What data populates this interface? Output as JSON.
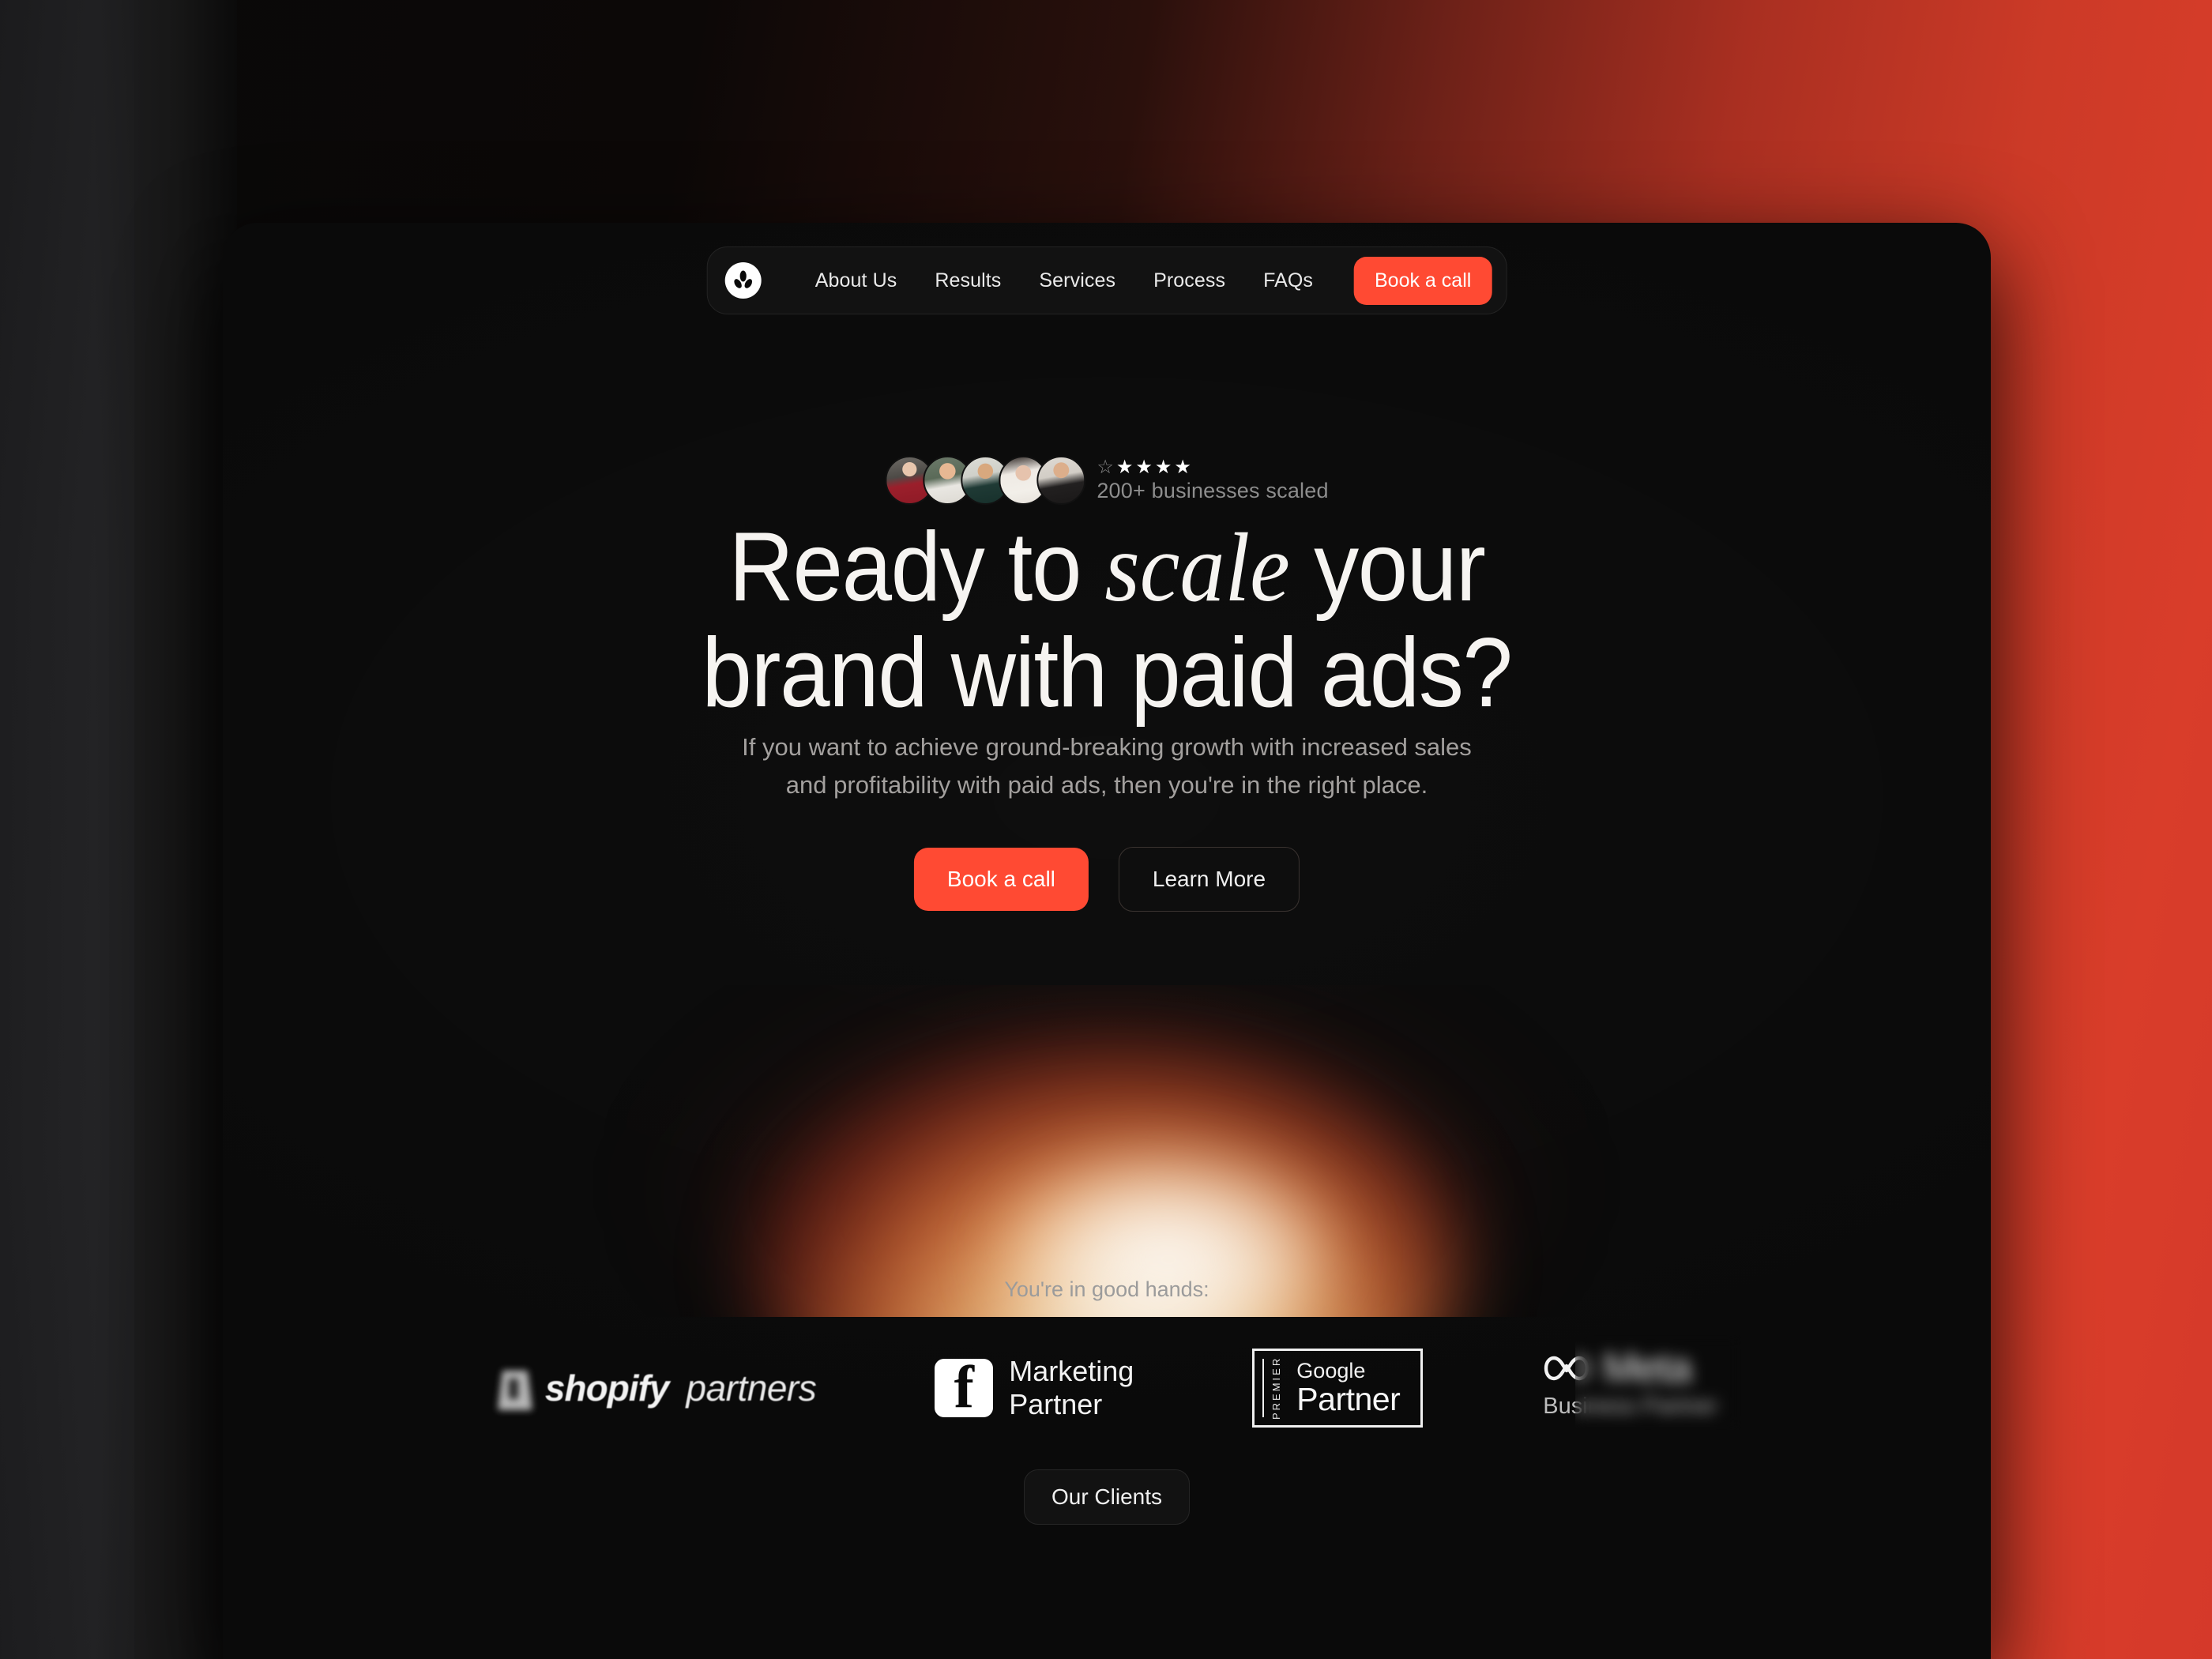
{
  "brand": {
    "logo_icon": "leaf-trio-circle-logo",
    "accent_color": "#ff4a33",
    "background_red": "#d93d2a",
    "card_background": "#0a0a0a"
  },
  "nav": {
    "links": [
      {
        "label": "About Us"
      },
      {
        "label": "Results"
      },
      {
        "label": "Services"
      },
      {
        "label": "Process"
      },
      {
        "label": "FAQs"
      }
    ],
    "cta_label": "Book a call"
  },
  "hero": {
    "social_proof": {
      "rating_stars_total": 5,
      "rating_stars_filled": 4,
      "rating_stars_outline": 1,
      "caption": "200+ businesses scaled",
      "avatar_count": 5
    },
    "headline_line1_before": "Ready to ",
    "headline_italic": "scale",
    "headline_line1_after": " your",
    "headline_line2": "brand with paid ads?",
    "subtext_line1": "If you want to achieve ground-breaking growth with increased sales",
    "subtext_line2": "and profitability with paid ads, then you're in the right place.",
    "cta_primary": "Book a call",
    "cta_secondary": "Learn More"
  },
  "partners": {
    "label": "You're in good hands:",
    "items": [
      {
        "name": "shopify-partners",
        "word_bold": "shopify",
        "word_light": "partners",
        "icon": "shopify-bag-icon"
      },
      {
        "name": "facebook-marketing-partner",
        "line1": "Marketing",
        "line2": "Partner",
        "icon": "facebook-f-icon"
      },
      {
        "name": "google-premier-partner",
        "premier": "PREMIER",
        "brand": "Google",
        "tier": "Partner"
      },
      {
        "name": "meta-business-partner",
        "brand": "Meta",
        "subtitle": "Business Partner",
        "icon": "meta-infinity-icon"
      }
    ]
  },
  "footer_section": {
    "pill_label": "Our Clients"
  }
}
